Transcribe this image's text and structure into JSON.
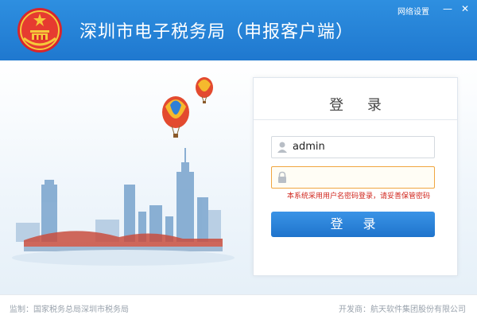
{
  "header": {
    "title": "深圳市电子税务局（申报客户端）",
    "network_settings": "网络设置",
    "minimize": "—",
    "close": "✕",
    "emblem_icon": "national-emblem-icon",
    "color": "#1f78cf"
  },
  "login": {
    "title": "登 录",
    "username": {
      "value": "admin",
      "icon": "user-icon"
    },
    "password": {
      "value": "",
      "icon": "lock-icon"
    },
    "hint": "本系统采用用户名密码登录，请妥善保管密码",
    "submit": "登 录",
    "accent": "#1f74cc",
    "hint_color": "#d0261d"
  },
  "footer": {
    "left": "监制：国家税务总局深圳市税务局",
    "right": "开发商：航天软件集团股份有限公司"
  }
}
